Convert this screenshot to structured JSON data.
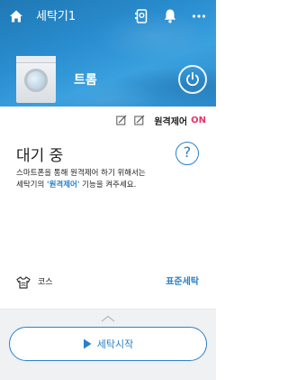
{
  "header": {
    "title": "세탁기1",
    "icons": [
      "home-icon",
      "remote-icon",
      "bell-icon",
      "more-icon"
    ]
  },
  "device": {
    "name": "트롬",
    "power_icon": "power-icon"
  },
  "status": {
    "remote_label": "원격제어",
    "remote_state": "ON",
    "remote_state_color": "#e8336b"
  },
  "main": {
    "state_title": "대기 중",
    "description_line1": "스마트폰을 통해 원격제어 하기 위해서는",
    "description_prefix": "세탁기의 ",
    "description_highlight": "'원격제어'",
    "description_suffix": " 기능을 켜주세요.",
    "help_symbol": "?"
  },
  "course": {
    "label": "코스",
    "value": "표준세탁"
  },
  "actions": {
    "start_label": "세탁시작"
  },
  "colors": {
    "accent": "#2a82c6",
    "hero": "#2a8ed0"
  }
}
